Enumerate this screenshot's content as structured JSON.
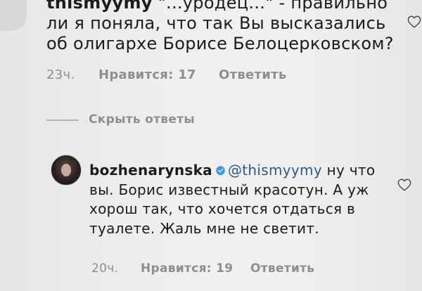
{
  "comment_1": {
    "username": "thismyymy",
    "text": "\"...уродец...\" - правильно ли я поняла, что так Вы высказались об олигархе Борисе Белоцерковском?",
    "time": "23ч.",
    "likes_label": "Нравится: 17",
    "reply_label": "Ответить",
    "like_icon": "heart-outline-icon"
  },
  "thread": {
    "hide_replies_label": "Скрыть ответы"
  },
  "comment_2": {
    "username": "bozhenarynska",
    "verified": true,
    "mention": "@thismyymy",
    "text": "ну что вы. Борис известный красотун. А уж хорош так, что хочется отдаться в туалете. Жаль мне не светит.",
    "time": "20ч.",
    "likes_label": "Нравится: 19",
    "reply_label": "Ответить",
    "like_icon": "heart-outline-icon"
  },
  "colors": {
    "background": "#efefef",
    "text": "#1c1c1c",
    "meta": "#8e8e8e",
    "mention": "#2e5a8a",
    "verified": "#3897f0"
  }
}
